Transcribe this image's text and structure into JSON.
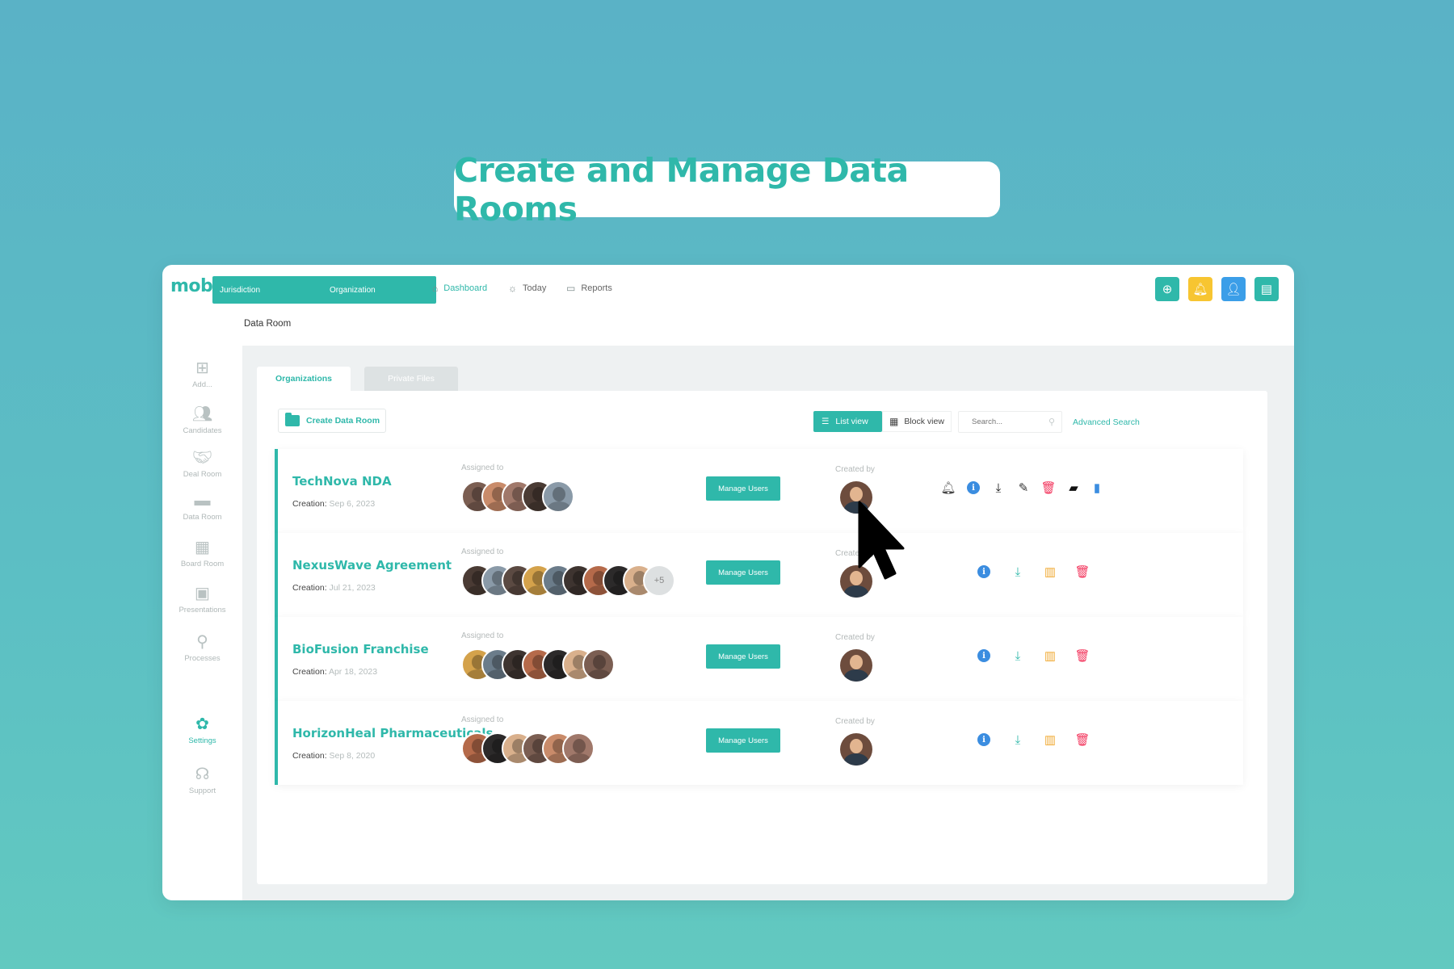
{
  "headline": "Create and Manage Data Rooms",
  "app": {
    "logo": "mob|lu",
    "top_selects": [
      "Jurisdiction",
      "Organization"
    ],
    "nav": [
      {
        "label": "Dashboard",
        "icon": "home-icon"
      },
      {
        "label": "Today",
        "icon": "sun-icon"
      },
      {
        "label": "Reports",
        "icon": "report-icon"
      }
    ],
    "top_buttons": [
      {
        "name": "add-icon",
        "color": "#2fb8aa"
      },
      {
        "name": "bell-icon",
        "color": "#f7c531"
      },
      {
        "name": "user-settings-icon",
        "color": "#3b9ee8"
      },
      {
        "name": "chat-icon",
        "color": "#2fb8aa"
      }
    ],
    "breadcrumb": "Data Room"
  },
  "sidebar": {
    "items": [
      {
        "label": "Add...",
        "icon": "add-square-icon",
        "active": false
      },
      {
        "label": "Candidates",
        "icon": "users-icon",
        "active": false
      },
      {
        "label": "Deal Room",
        "icon": "handshake-icon",
        "active": false
      },
      {
        "label": "Data Room",
        "icon": "folder-icon",
        "active": false
      },
      {
        "label": "Board Room",
        "icon": "calendar-icon",
        "active": false
      },
      {
        "label": "Presentations",
        "icon": "presentation-icon",
        "active": false
      },
      {
        "label": "Processes",
        "icon": "process-icon",
        "active": false
      },
      {
        "label": "Settings",
        "icon": "gear-icon",
        "active": true
      },
      {
        "label": "Support",
        "icon": "headset-icon",
        "active": false
      }
    ]
  },
  "tabs": [
    "Organizations",
    "Private Files"
  ],
  "toolbar": {
    "create_label": "Create Data Room",
    "list_view": "List view",
    "block_view": "Block view",
    "search_placeholder": "Search...",
    "advanced_search": "Advanced Search"
  },
  "labels": {
    "assigned_to": "Assigned to",
    "created_by": "Created by",
    "creation": "Creation:",
    "manage_users": "Manage Users"
  },
  "rooms": [
    {
      "title": "TechNova NDA",
      "date": "Sep 6, 2023",
      "assignees": 5,
      "more": "",
      "actions": "full"
    },
    {
      "title": "NexusWave Agreement",
      "date": "Jul 21, 2023",
      "assignees": 9,
      "more": "+5",
      "actions": "short"
    },
    {
      "title": "BioFusion Franchise",
      "date": "Apr 18, 2023",
      "assignees": 7,
      "more": "",
      "actions": "short"
    },
    {
      "title": "HorizonHeal Pharmaceuticals",
      "date": "Sep 8, 2020",
      "assignees": 6,
      "more": "",
      "actions": "short"
    }
  ],
  "colors": {
    "accent": "#2fb8aa",
    "info": "#3b8de0",
    "download": "#2fb8aa",
    "chart": "#f0a830",
    "delete": "#f2325a"
  }
}
